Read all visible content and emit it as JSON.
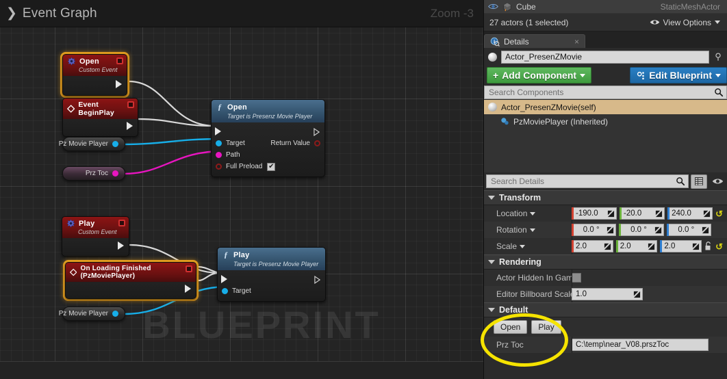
{
  "graph": {
    "breadcrumb_icon": "chevron-right-icon",
    "title": "Event Graph",
    "zoom_label": "Zoom -3",
    "watermark": "BLUEPRINT",
    "nodes": [
      {
        "id": "open-custom-event",
        "kind": "event",
        "title": "Open",
        "subtitle": "Custom Event",
        "icon": "custom-event-icon",
        "selected": true,
        "has_delegate_pin": true,
        "exec_out": true
      },
      {
        "id": "event-begin-play",
        "kind": "event",
        "title": "Event BeginPlay",
        "subtitle": "",
        "icon": "event-diamond-icon",
        "selected": false,
        "has_delegate_pin": true,
        "exec_out": true
      },
      {
        "id": "open-function",
        "kind": "function",
        "title": "Open",
        "subtitle": "Target is Presenz Movie Player",
        "icon": "function-f-icon",
        "inputs": [
          {
            "label": "Target",
            "pin": "object",
            "color": "#17aee8"
          },
          {
            "label": "Path",
            "pin": "string",
            "color": "#e815c0"
          },
          {
            "label": "Full Preload",
            "pin": "bool",
            "color": "#8d1a1a",
            "checkbox": true,
            "checked": true
          }
        ],
        "outputs": [
          {
            "label": "Return Value",
            "pin": "bool",
            "color": "#8d1a1a"
          }
        ]
      },
      {
        "id": "play-custom-event",
        "kind": "event",
        "title": "Play",
        "subtitle": "Custom Event",
        "icon": "custom-event-icon",
        "selected": false,
        "has_delegate_pin": true,
        "exec_out": true
      },
      {
        "id": "on-loading-finished-event",
        "kind": "event",
        "title": "On Loading Finished (PzMoviePlayer)",
        "subtitle": "",
        "icon": "event-diamond-icon",
        "selected": true,
        "has_delegate_pin": true,
        "exec_out": true
      },
      {
        "id": "play-function",
        "kind": "function",
        "title": "Play",
        "subtitle": "Target is Presenz Movie Player",
        "icon": "function-f-icon",
        "inputs": [
          {
            "label": "Target",
            "pin": "object",
            "color": "#17aee8"
          }
        ],
        "outputs": []
      }
    ],
    "variables": [
      {
        "id": "pz-movie-player-1",
        "label": "Pz Movie Player",
        "color": "blue"
      },
      {
        "id": "prz-toc",
        "label": "Prz Toc",
        "color": "magenta"
      },
      {
        "id": "pz-movie-player-2",
        "label": "Pz Movie Player",
        "color": "blue"
      }
    ]
  },
  "outliner": {
    "row": {
      "name": "Cube",
      "type": "StaticMeshActor",
      "visibility_icon": "eye-icon",
      "actor_icon": "cube-icon"
    },
    "status": "27 actors (1 selected)",
    "view_options": "View Options",
    "view_options_icon": "eye-icon"
  },
  "details": {
    "tab_label": "Details",
    "tab_icon": "details-info-icon",
    "tab_close_icon": "close-icon",
    "actor_name": "Actor_PresenZMovie",
    "actor_icon": "sphere-icon",
    "pin_icon": "pin-icon",
    "add_component_label": "Add Component",
    "edit_blueprint_label": "Edit Blueprint",
    "edit_blueprint_icon": "blueprint-gear-icon",
    "search_components_placeholder": "Search Components",
    "search_components_icon": "search-icon",
    "components": [
      {
        "label": "Actor_PresenZMovie(self)",
        "selected": true,
        "icon": "sphere-icon",
        "indent": 0
      },
      {
        "label": "PzMoviePlayer (Inherited)",
        "selected": false,
        "icon": "component-blob-icon",
        "indent": 1
      }
    ],
    "search_details_placeholder": "Search Details",
    "search_details_icon": "search-icon",
    "grid_view_icon": "grid-icon",
    "visibility_icon": "eye-icon",
    "sections": [
      {
        "name": "Transform",
        "rows": [
          {
            "label": "Location",
            "has_caret": true,
            "type": "vector",
            "values": [
              "-190.0",
              "-20.0",
              "240.0"
            ],
            "axis_colors": [
              "#d2402f",
              "#6ab23a",
              "#2f7fd2"
            ],
            "reset": true,
            "lock": false
          },
          {
            "label": "Rotation",
            "has_caret": true,
            "type": "vector",
            "values": [
              "0.0 °",
              "0.0 °",
              "0.0 °"
            ],
            "axis_colors": [
              "#d2402f",
              "#6ab23a",
              "#2f7fd2"
            ],
            "reset": false,
            "lock": false
          },
          {
            "label": "Scale",
            "has_caret": true,
            "type": "vector",
            "values": [
              "2.0",
              "2.0",
              "2.0"
            ],
            "axis_colors": [
              "#d2402f",
              "#6ab23a",
              "#2f7fd2"
            ],
            "reset": true,
            "lock": true
          }
        ]
      },
      {
        "name": "Rendering",
        "rows": [
          {
            "label": "Actor Hidden In Game",
            "type": "checkbox",
            "checked": false
          },
          {
            "label": "Editor Billboard Scale",
            "type": "number",
            "value": "1.0"
          }
        ]
      },
      {
        "name": "Default",
        "highlighted": true,
        "rows": [
          {
            "type": "buttons",
            "buttons": [
              "Open",
              "Play"
            ]
          },
          {
            "label": "Prz Toc",
            "type": "text",
            "value": "C:\\temp\\near_V08.prszToc"
          }
        ]
      }
    ]
  },
  "colors": {
    "highlight": "#f5e300",
    "node_select": "#e8a020",
    "exec_wire": "#d8d8d8",
    "object_wire": "#17aee8",
    "string_wire": "#e815c0",
    "green_button": "#4aa24a",
    "blue_button": "#2a7fc4"
  }
}
